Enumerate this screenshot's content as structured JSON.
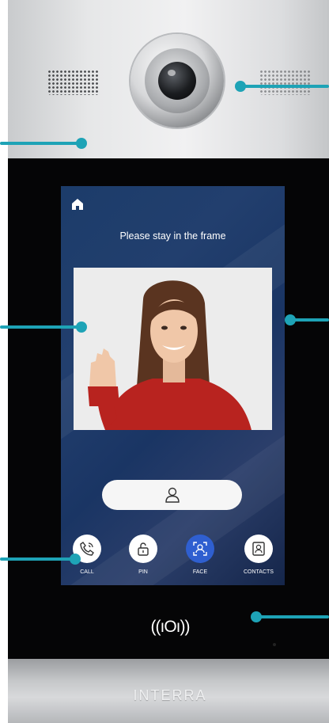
{
  "screen": {
    "prompt": "Please stay in the frame",
    "actions": [
      {
        "label": "CALL",
        "icon": "phone-icon",
        "active": false
      },
      {
        "label": "PIN",
        "icon": "unlock-icon",
        "active": false
      },
      {
        "label": "FACE",
        "icon": "face-scan-icon",
        "active": true
      },
      {
        "label": "CONTACTS",
        "icon": "contacts-icon",
        "active": false
      }
    ]
  },
  "device": {
    "nfc_symbol": "((ıOı))",
    "brand": "INTERRA"
  },
  "colors": {
    "callout": "#1ea3b6",
    "face_button": "#2f5fd0",
    "screen_bg": "#1c3c6a"
  }
}
